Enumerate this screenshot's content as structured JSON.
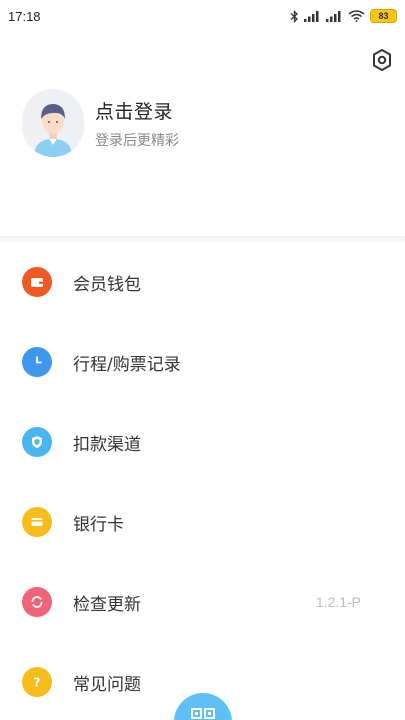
{
  "status_bar": {
    "time": "17:18",
    "battery": "83"
  },
  "profile": {
    "title": "点击登录",
    "subtitle": "登录后更精彩"
  },
  "menu": [
    {
      "label": "会员钱包",
      "icon": "wallet-icon",
      "color": "#f05a22"
    },
    {
      "label": "行程/购票记录",
      "icon": "clock-icon",
      "color": "#3f97ee"
    },
    {
      "label": "扣款渠道",
      "icon": "shield-icon",
      "color": "#49b6f1"
    },
    {
      "label": "银行卡",
      "icon": "card-icon",
      "color": "#f5bd1b"
    },
    {
      "label": "检查更新",
      "icon": "refresh-icon",
      "color": "#f0647a",
      "value": "1.2.1-P"
    },
    {
      "label": "常见问题",
      "icon": "question-icon",
      "color": "#f5bd1b"
    }
  ],
  "colors": {
    "accent": "#5fc0f6"
  }
}
